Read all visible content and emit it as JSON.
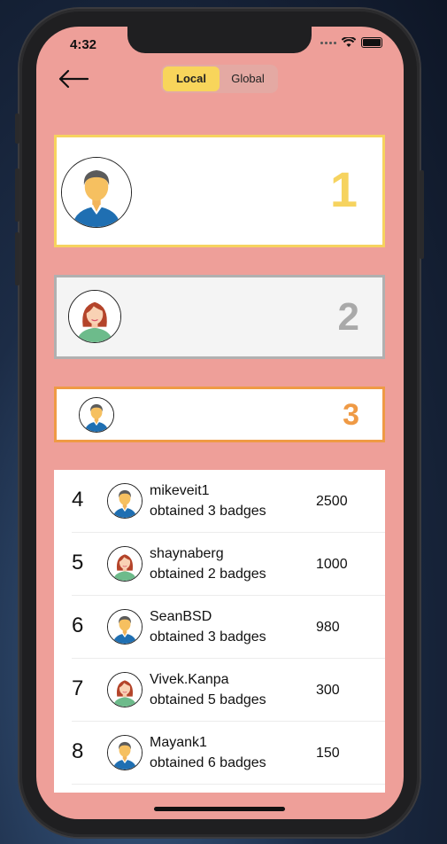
{
  "status_bar": {
    "time": "4:32"
  },
  "nav": {
    "back_icon": "back-arrow-icon"
  },
  "toggle": {
    "options": [
      {
        "label": "Local",
        "active": true
      },
      {
        "label": "Global",
        "active": false
      }
    ]
  },
  "podium": [
    {
      "rank": "1",
      "avatar": "male",
      "accent": "#f6d35f"
    },
    {
      "rank": "2",
      "avatar": "female",
      "accent": "#a9a9a9"
    },
    {
      "rank": "3",
      "avatar": "male",
      "accent": "#ef9a45"
    }
  ],
  "leaderboard": [
    {
      "rank": "4",
      "name": "mikeveit1",
      "badges": "obtained 3 badges",
      "score": "2500",
      "avatar": "male"
    },
    {
      "rank": "5",
      "name": "shaynaberg",
      "badges": "obtained 2 badges",
      "score": "1000",
      "avatar": "female"
    },
    {
      "rank": "6",
      "name": "SeanBSD",
      "badges": "obtained 3 badges",
      "score": "980",
      "avatar": "male"
    },
    {
      "rank": "7",
      "name": "Vivek.Kanpa",
      "badges": "obtained 5 badges",
      "score": "300",
      "avatar": "female"
    },
    {
      "rank": "8",
      "name": "Mayank1",
      "badges": "obtained 6 badges",
      "score": "150",
      "avatar": "male"
    }
  ],
  "colors": {
    "background": "#ee9f99",
    "gold": "#f6d35f",
    "silver": "#a9a9a9",
    "bronze": "#ef9a45",
    "toggle_active": "#f8d55b"
  }
}
